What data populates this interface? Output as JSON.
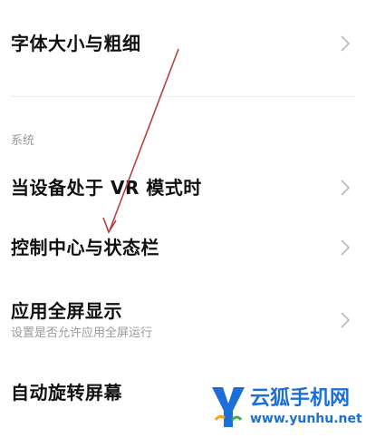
{
  "settings": {
    "font_size_weight": {
      "title": "字体大小与粗细"
    },
    "section_system": "系统",
    "vr_mode": {
      "title": "当设备处于 VR 模式时"
    },
    "control_center": {
      "title": "控制中心与状态栏"
    },
    "fullscreen": {
      "title": "应用全屏显示",
      "subtitle": "设置是否允许应用全屏运行"
    },
    "auto_rotate": {
      "title": "自动旋转屏幕"
    }
  },
  "watermark": {
    "title": "云狐手机网",
    "url": "www.yunhu.net",
    "color": "#1c6fd8"
  },
  "colors": {
    "annotation_arrow": "#b5413b",
    "chevron": "#b8b8b8"
  }
}
